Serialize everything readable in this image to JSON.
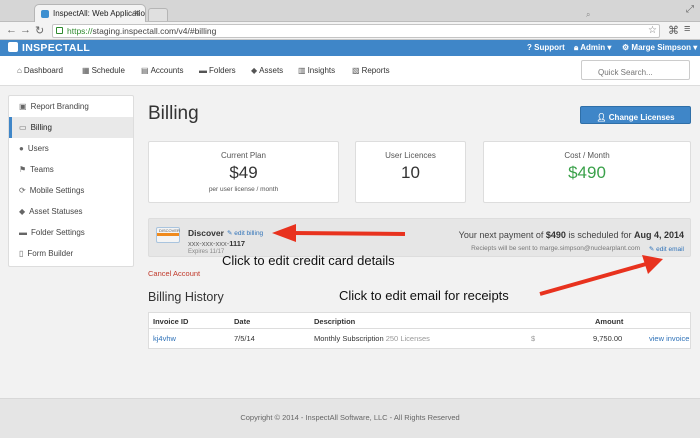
{
  "browser": {
    "tab_title": "InspectAll: Web Application",
    "url_scheme": "https://",
    "url_rest": "staging.inspectall.com/v4/#billing"
  },
  "appbar": {
    "brand": "INSPECTALL",
    "support": "Support",
    "admin": "Admin",
    "user": "Marge Simpson"
  },
  "subnav": {
    "items": [
      {
        "label": "Dashboard",
        "icon": "home-icon"
      },
      {
        "label": "Schedule",
        "icon": "calendar-icon"
      },
      {
        "label": "Accounts",
        "icon": "building-icon"
      },
      {
        "label": "Folders",
        "icon": "folder-icon"
      },
      {
        "label": "Assets",
        "icon": "tag-icon"
      },
      {
        "label": "Insights",
        "icon": "chart-icon"
      },
      {
        "label": "Reports",
        "icon": "reports-icon"
      }
    ],
    "search_placeholder": "Quick Search..."
  },
  "sidebar": {
    "items": [
      {
        "label": "Report Branding",
        "icon": "image-icon",
        "active": false
      },
      {
        "label": "Billing",
        "icon": "credit-card-icon",
        "active": true
      },
      {
        "label": "Users",
        "icon": "user-icon",
        "active": false
      },
      {
        "label": "Teams",
        "icon": "flag-icon",
        "active": false
      },
      {
        "label": "Mobile Settings",
        "icon": "refresh-icon",
        "active": false
      },
      {
        "label": "Asset Statuses",
        "icon": "tag-icon",
        "active": false
      },
      {
        "label": "Folder Settings",
        "icon": "folder-icon",
        "active": false
      },
      {
        "label": "Form Builder",
        "icon": "document-icon",
        "active": false
      }
    ]
  },
  "main": {
    "title": "Billing",
    "change_licenses": "Change Licenses",
    "cards": {
      "plan": {
        "label": "Current Plan",
        "value": "$49",
        "sub": "per user license / month"
      },
      "licences": {
        "label": "User Licences",
        "value": "10"
      },
      "cost": {
        "label": "Cost / Month",
        "value": "$490"
      }
    },
    "payment": {
      "card_brand": "Discover",
      "edit_billing": "edit billing",
      "card_masked": "xxx-xxx-xxx-",
      "card_last4": "1117",
      "expires": "Expires 11/17",
      "next_prefix": "Your next payment of ",
      "next_amount": "$490",
      "next_mid": " is scheduled for ",
      "next_date": "Aug 4, 2014",
      "receipts": "Reciepts will be sent to marge.simpson@nuclearplant.com",
      "edit_email": "edit email"
    },
    "cancel_account": "Cancel Account",
    "history_title": "Billing History",
    "table": {
      "headers": [
        "Invoice ID",
        "Date",
        "Description",
        "Amount"
      ],
      "rows": [
        {
          "invoice": "kj4vhw",
          "date": "7/5/14",
          "description": "Monthly Subscription",
          "licenses": "250 Licenses",
          "currency": "$",
          "amount": "9,750.00",
          "action": "view invoice"
        }
      ]
    }
  },
  "annotations": {
    "credit_card": "Click to edit credit card details",
    "email": "Click to edit email for receipts",
    "arrow_color": "#e8321e"
  },
  "footer": "Copyright © 2014 - InspectAll Software, LLC - All Rights Reserved",
  "colors": {
    "accent": "#3f86c8",
    "positive": "#3aa14a",
    "danger": "#c0392b"
  }
}
